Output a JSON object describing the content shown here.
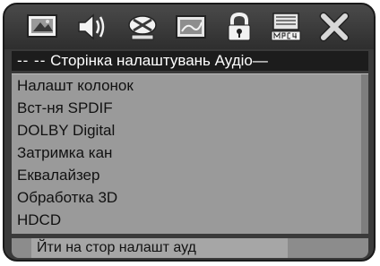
{
  "icon_bar": {
    "icons": [
      {
        "name": "general-setup-icon"
      },
      {
        "name": "audio-setup-icon"
      },
      {
        "name": "dolby-setup-icon"
      },
      {
        "name": "video-setup-icon"
      },
      {
        "name": "lock-icon"
      },
      {
        "name": "mpeg4-setup-icon"
      },
      {
        "name": "exit-icon"
      }
    ],
    "selected_index": 1
  },
  "page": {
    "title": "Сторінка налаштувань Аудіо",
    "title_prefix": "-- --",
    "title_suffix": "—"
  },
  "menu": {
    "items": [
      {
        "label": "Налашт колонок"
      },
      {
        "label": "Вст-ня SPDIF"
      },
      {
        "label": "DOLBY Digital"
      },
      {
        "label": "Затримка кан"
      },
      {
        "label": "Еквалайзер"
      },
      {
        "label": "Обработка 3D"
      },
      {
        "label": "HDCD"
      }
    ]
  },
  "status": {
    "text": "Йти на стор налашт ауд"
  },
  "colors": {
    "frame": "#3a3a3a",
    "menu_bg": "#9a9a9a",
    "title_bg": "#1c1c1c",
    "status_bg": "#a6a6a6"
  }
}
